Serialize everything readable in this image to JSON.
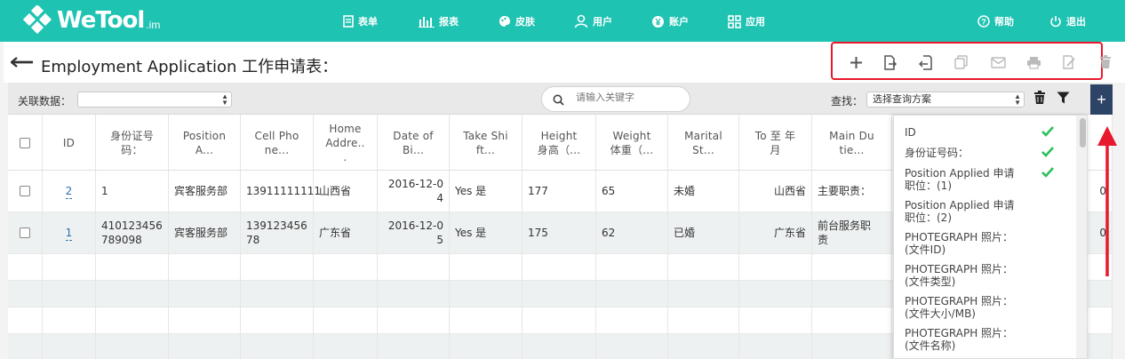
{
  "app": {
    "logo_word": "WeTool",
    "logo_suffix": ".im"
  },
  "nav": {
    "items": [
      {
        "label": "表单",
        "icon": "document-icon"
      },
      {
        "label": "报表",
        "icon": "bar-chart-icon"
      },
      {
        "label": "皮肤",
        "icon": "palette-icon"
      },
      {
        "label": "用户",
        "icon": "user-icon"
      },
      {
        "label": "账户",
        "icon": "yen-coin-icon"
      },
      {
        "label": "应用",
        "icon": "grid-icon"
      }
    ],
    "help_label": "帮助",
    "logout_label": "退出"
  },
  "page": {
    "title": "Employment Application 工作申请表："
  },
  "toolbar": {
    "buttons": [
      "plus-icon",
      "import-icon",
      "export-icon",
      "copy-icon",
      "mail-icon",
      "print-icon",
      "edit-icon",
      "trash-icon"
    ]
  },
  "filter": {
    "related_label": "关联数据：",
    "related_value": "",
    "search_placeholder": "请输入关键字",
    "find_label": "查找：",
    "scheme_value": "选择查询方案"
  },
  "table": {
    "columns": [
      "ID",
      "身份证号码：",
      "Position A...",
      "Cell Phone...",
      "Home Addre...",
      "Date of Bi...",
      "Take Shift...",
      "Height 身高（...",
      "Weight 体重（...",
      "Marital St...",
      "To 至 年月",
      "Main Dutie..."
    ],
    "header_lines": [
      [
        "ID"
      ],
      [
        "身份证号",
        "码："
      ],
      [
        "Position",
        "A..."
      ],
      [
        "Cell Pho",
        "ne..."
      ],
      [
        "Home",
        "Addre..",
        "."
      ],
      [
        "Date of",
        "Bi..."
      ],
      [
        "Take Shi",
        "ft..."
      ],
      [
        "Height",
        "身高（..."
      ],
      [
        "Weight",
        "体重（..."
      ],
      [
        "Marital",
        "St..."
      ],
      [
        "To 至 年",
        "月"
      ],
      [
        "Main Du",
        "tie..."
      ]
    ],
    "rows": [
      {
        "id": "2",
        "id_no": "1",
        "position": "宾客服务部",
        "phone": "13911111111",
        "address": "山西省",
        "dob": "2016-12-04",
        "shift": "Yes 是",
        "height": "177",
        "weight": "65",
        "marital": "未婚",
        "to": "山西省",
        "duties": "主要职责：",
        "tail": "0"
      },
      {
        "id": "1",
        "id_no": "410123456789098",
        "position": "宾客服务部",
        "phone": "13912345678",
        "address": "广东省",
        "dob": "2016-12-05",
        "shift": "Yes 是",
        "height": "175",
        "weight": "62",
        "marital": "已婚",
        "to": "广东省",
        "duties": "前台服务职责",
        "tail": "0"
      }
    ],
    "rows_display": [
      {
        "id_no": [
          "1"
        ],
        "phone": [
          "13911111111"
        ],
        "dob": [
          "2016-12-0",
          "4"
        ],
        "duties": [
          "主要职责："
        ],
        "tail": "0"
      },
      {
        "id_no": [
          "410123456",
          "789098"
        ],
        "phone": [
          "139123456",
          "78"
        ],
        "dob": [
          "2016-12-0",
          "5"
        ],
        "duties": [
          "前台服务职",
          "责"
        ],
        "tail": "0"
      }
    ]
  },
  "column_picker": {
    "items": [
      {
        "label": [
          "ID"
        ],
        "checked": true
      },
      {
        "label": [
          "身份证号码："
        ],
        "checked": true
      },
      {
        "label": [
          "Position Applied 申请",
          "职位：(1)"
        ],
        "checked": true
      },
      {
        "label": [
          "Position Applied 申请",
          "职位：(2)"
        ],
        "checked": false
      },
      {
        "label": [
          "PHOTEGRAPH 照片：",
          "(文件ID)"
        ],
        "checked": false
      },
      {
        "label": [
          "PHOTEGRAPH 照片：",
          "(文件类型)"
        ],
        "checked": false
      },
      {
        "label": [
          "PHOTEGRAPH 照片：",
          "(文件大小/MB)"
        ],
        "checked": false
      },
      {
        "label": [
          "PHOTEGRAPH 照片：",
          "(文件名称)"
        ],
        "checked": false
      }
    ]
  },
  "colors": {
    "brand": "#1fc3b2",
    "highlight_border": "#e8192c",
    "add_column_button": "#2e4466",
    "check": "#2bbf5b"
  }
}
